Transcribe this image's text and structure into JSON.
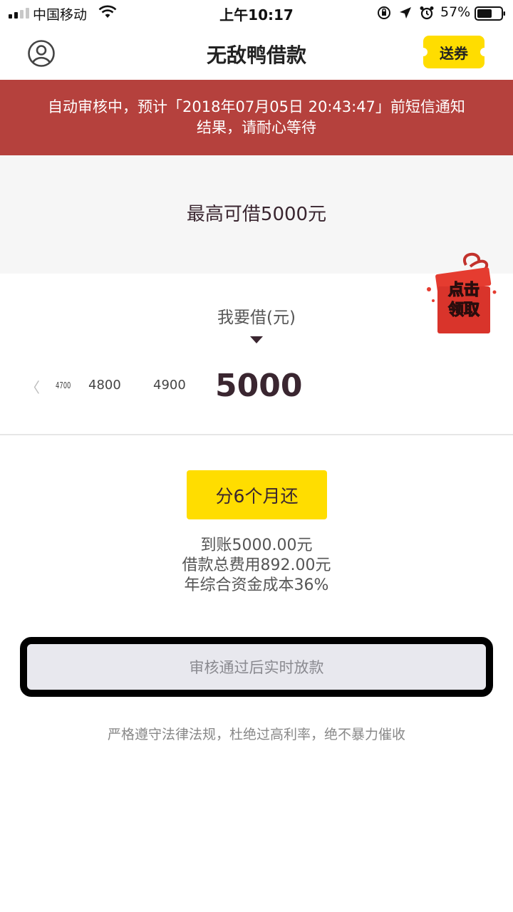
{
  "status_bar": {
    "carrier": "中国移动",
    "time": "上午10:17",
    "battery": "57%"
  },
  "nav": {
    "title": "无敌鸭借款",
    "coupon_label": "送券"
  },
  "banner": {
    "line1": "自动审核中，预计「2018年07月05日 20:43:47」前短信通知",
    "line2": "结果，请耐心等待"
  },
  "max_amount": {
    "label": "最高可借5000元"
  },
  "gift": {
    "label_line1": "点击",
    "label_line2": "领取"
  },
  "picker": {
    "label": "我要借(元)",
    "chevron": "〈",
    "ticks": [
      "4700",
      "4800",
      "4900",
      "5000"
    ]
  },
  "term": {
    "label": "分6个月还"
  },
  "info": {
    "received": "到账5000.00元",
    "total_fee": "借款总费用892.00元",
    "annual_cost": "年综合资金成本36%"
  },
  "submit": {
    "label": "审核通过后实时放款"
  },
  "footer": {
    "note": "严格遵守法律法规，杜绝过高利率，绝不暴力催收"
  },
  "colors": {
    "accent_yellow": "#ffdd00",
    "banner_red": "#b5413d",
    "text_dark": "#3a2630"
  }
}
